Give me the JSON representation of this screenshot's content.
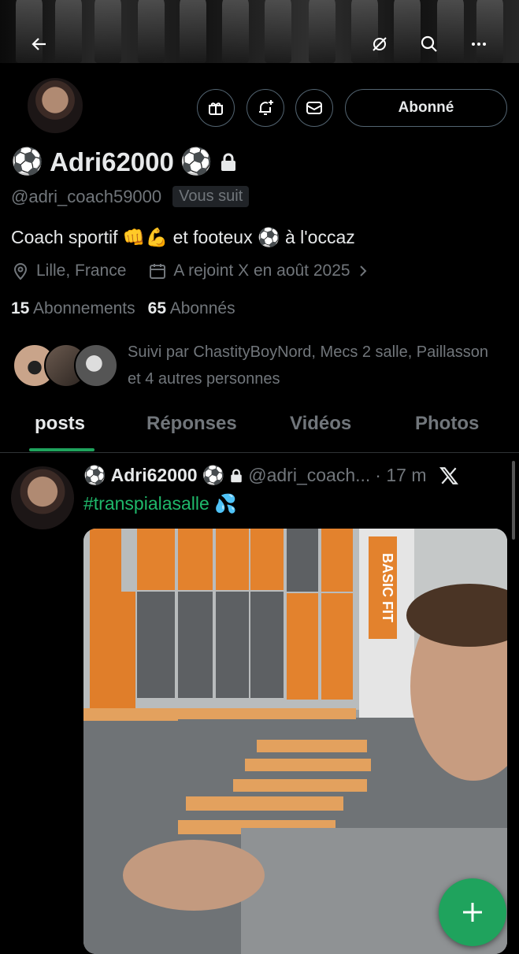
{
  "header": {
    "back_icon": "arrow-left-icon",
    "grok_icon": "grok-icon",
    "search_icon": "search-icon",
    "more_icon": "more-dots-icon"
  },
  "profile": {
    "actions": {
      "gift_icon": "gift-icon",
      "notify_icon": "bell-plus-icon",
      "message_icon": "envelope-icon",
      "follow_label": "Abonné"
    },
    "name": "Adri62000",
    "name_emoji": "⚽",
    "lock_icon": "lock-icon",
    "handle": "@adri_coach59000",
    "follows_you": "Vous suit",
    "bio": "Coach sportif 👊💪 et footeux ⚽ à l'occaz",
    "location": "Lille, France",
    "joined": "A rejoint X en août 2025",
    "following_count": "15",
    "following_label": "Abonnements",
    "followers_count": "65",
    "followers_label": "Abonnés",
    "followed_by": "Suivi par ChastityBoyNord, Mecs 2 salle, Paillasson et 4 autres personnes"
  },
  "tabs": [
    "posts",
    "Réponses",
    "Vidéos",
    "Photos"
  ],
  "post": {
    "name": "Adri62000",
    "handle": "@adri_coach...",
    "time": "· 17 m",
    "hashtag": "#transpialasalle 💦",
    "media_sign": "BASIC FIT"
  },
  "colors": {
    "accent": "#1fa35d",
    "muted": "#71767b",
    "text": "#e7e9ea",
    "border": "#2f3336"
  }
}
